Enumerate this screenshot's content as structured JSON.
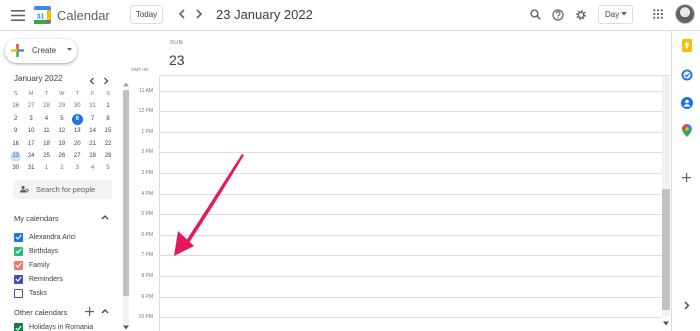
{
  "header": {
    "app_title": "Calendar",
    "logo_number": "31",
    "today_label": "Today",
    "date_title": "23 January 2022",
    "view_label": "Day",
    "icons": [
      "menu-icon",
      "chevron-left-icon",
      "chevron-right-icon",
      "search-icon",
      "help-icon",
      "gear-icon",
      "apps-grid-icon",
      "avatar"
    ]
  },
  "sidebar": {
    "create_label": "Create",
    "mini_calendar": {
      "month_label": "January 2022",
      "weekday_headers": [
        "S",
        "M",
        "T",
        "W",
        "T",
        "F",
        "S"
      ],
      "weeks": [
        [
          "26",
          "27",
          "28",
          "29",
          "30",
          "31",
          "1"
        ],
        [
          "2",
          "3",
          "4",
          "5",
          "6",
          "7",
          "8"
        ],
        [
          "9",
          "10",
          "11",
          "12",
          "13",
          "14",
          "15"
        ],
        [
          "16",
          "17",
          "18",
          "19",
          "20",
          "21",
          "22"
        ],
        [
          "23",
          "24",
          "25",
          "26",
          "27",
          "28",
          "29"
        ],
        [
          "30",
          "31",
          "1",
          "2",
          "3",
          "4",
          "5"
        ]
      ],
      "today": "6",
      "selected": "23"
    },
    "people_search_placeholder": "Search for people",
    "my_calendars_title": "My calendars",
    "my_calendars": [
      {
        "label": "Alexandra Arici",
        "color": "#1a73e8",
        "checked": true
      },
      {
        "label": "Birthdays",
        "color": "#33b679",
        "checked": true
      },
      {
        "label": "Family",
        "color": "#e67c73",
        "checked": true
      },
      {
        "label": "Reminders",
        "color": "#3f51b5",
        "checked": true
      },
      {
        "label": "Tasks",
        "color": "#3f51b5",
        "checked": false
      }
    ],
    "other_calendars_title": "Other calendars",
    "other_calendars": [
      {
        "label": "Holidays in Romania",
        "color": "#0b8043",
        "checked": true
      }
    ]
  },
  "day_view": {
    "day_name": "SUN",
    "day_number": "23",
    "timezone": "GMT+02",
    "hours": [
      "11 AM",
      "12 PM",
      "1 PM",
      "2 PM",
      "3 PM",
      "4 PM",
      "5 PM",
      "6 PM",
      "7 PM",
      "8 PM",
      "9 PM",
      "10 PM"
    ]
  },
  "addons": [
    "keep-icon",
    "tasks-icon",
    "contacts-icon",
    "maps-icon",
    "add-icon"
  ],
  "colors": {
    "accent": "#1a73e8",
    "annotation_arrow": "#e8175d"
  }
}
